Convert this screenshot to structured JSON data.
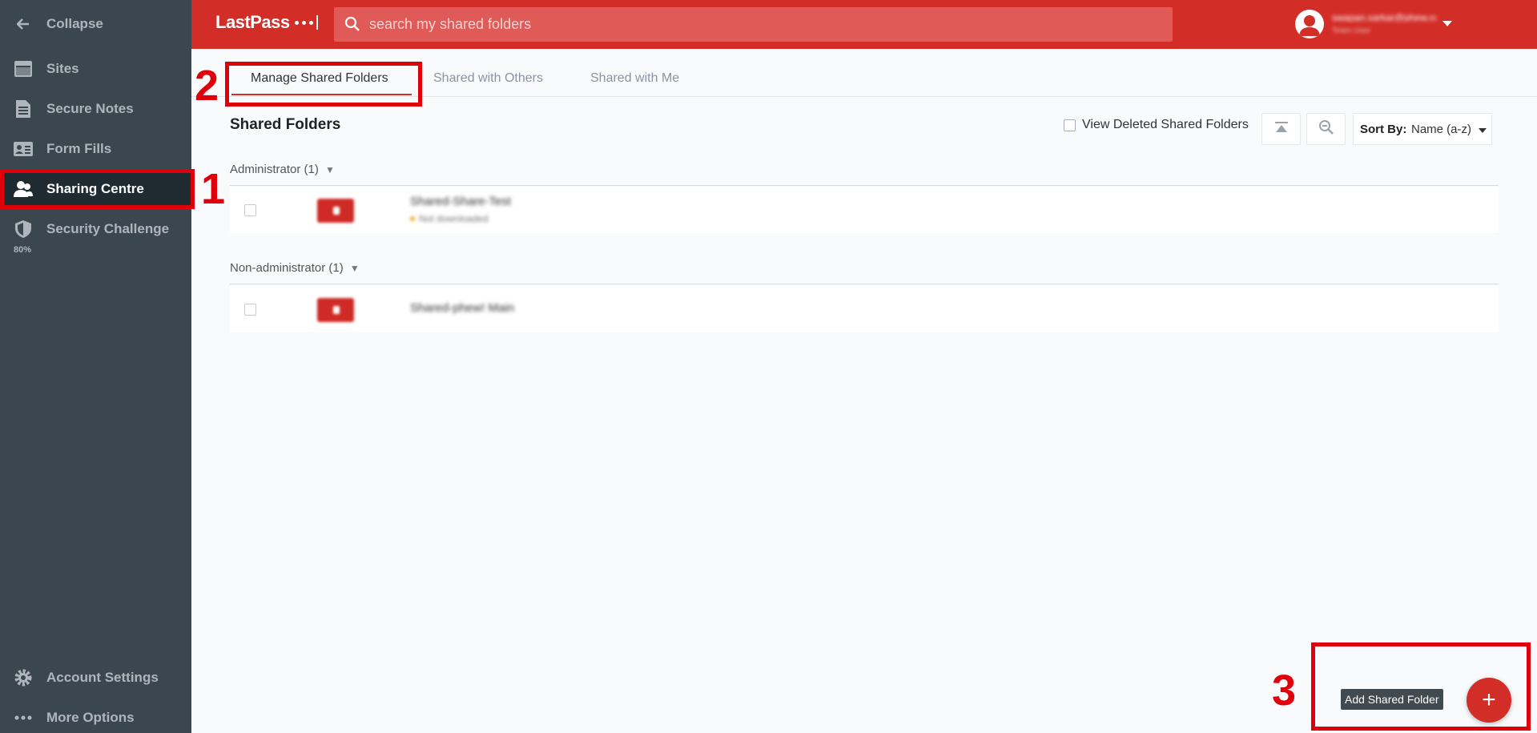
{
  "sidebar": {
    "collapse": "Collapse",
    "items": [
      {
        "label": "Sites",
        "icon": "sites-icon"
      },
      {
        "label": "Secure Notes",
        "icon": "note-icon"
      },
      {
        "label": "Form Fills",
        "icon": "form-fill-icon"
      },
      {
        "label": "Sharing Centre",
        "icon": "sharing-icon"
      },
      {
        "label": "Security Challenge",
        "icon": "shield-icon",
        "sub": "80%"
      }
    ],
    "bottom": [
      {
        "label": "Account Settings",
        "icon": "gear-icon"
      },
      {
        "label": "More Options",
        "icon": "more-icon"
      }
    ]
  },
  "header": {
    "logo": "LastPass",
    "search_placeholder": "search my shared folders",
    "user_email": "swapan.sarkar@phew.co.nz",
    "user_role": "Team User"
  },
  "tabs": [
    {
      "label": "Manage Shared Folders",
      "active": true
    },
    {
      "label": "Shared with Others"
    },
    {
      "label": "Shared with Me"
    }
  ],
  "main": {
    "title": "Shared Folders",
    "view_deleted": "View Deleted Shared Folders",
    "sort_label": "Sort By:",
    "sort_value": "Name (a-z)",
    "groups": [
      {
        "header": "Administrator (1)",
        "rows": [
          {
            "name": "Shared-Share-Test",
            "status": "Not downloaded"
          }
        ]
      },
      {
        "header": "Non-administrator (1)",
        "rows": [
          {
            "name": "Shared-phew! Main"
          }
        ]
      }
    ]
  },
  "fab": {
    "tooltip": "Add Shared Folder",
    "symbol": "+"
  },
  "annotations": [
    "1",
    "2",
    "3"
  ],
  "colors": {
    "brand_red": "#d32d27",
    "sidebar_bg": "#3b474f",
    "annotation_red": "#e0000b"
  }
}
